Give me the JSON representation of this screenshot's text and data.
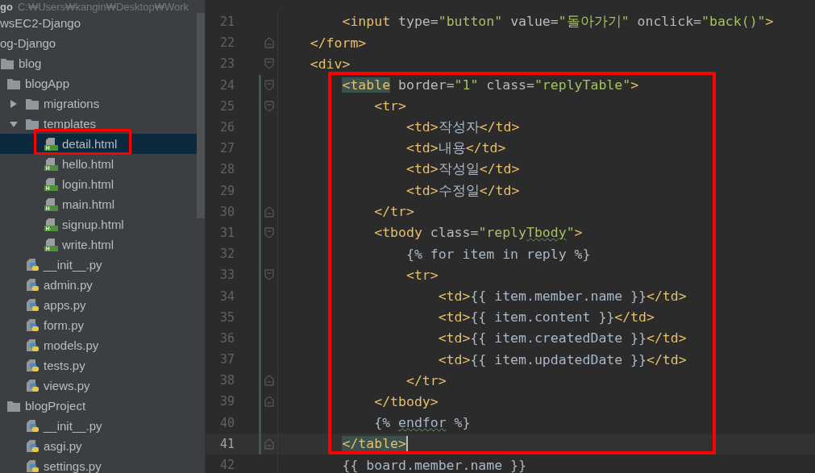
{
  "sidebar": {
    "root": {
      "name": "go",
      "path": "C:₩Users₩kangin₩Desktop₩Work"
    },
    "items": [
      {
        "label": "wsEC2-Django",
        "kind": "text",
        "selected": false
      },
      {
        "label": "og-Django",
        "kind": "text",
        "selected": false
      },
      {
        "label": "blog",
        "kind": "folder",
        "selected": false,
        "children": [
          {
            "label": "blogApp",
            "kind": "folder",
            "selected": false,
            "children": [
              {
                "label": "migrations",
                "kind": "folder",
                "expanded": false,
                "selected": false
              },
              {
                "label": "templates",
                "kind": "folder",
                "expanded": true,
                "selected": false,
                "children": [
                  {
                    "label": "detail.html",
                    "kind": "html",
                    "selected": true
                  },
                  {
                    "label": "hello.html",
                    "kind": "html",
                    "selected": false
                  },
                  {
                    "label": "login.html",
                    "kind": "html",
                    "selected": false
                  },
                  {
                    "label": "main.html",
                    "kind": "html",
                    "selected": false
                  },
                  {
                    "label": "signup.html",
                    "kind": "html",
                    "selected": false
                  },
                  {
                    "label": "write.html",
                    "kind": "html",
                    "selected": false
                  }
                ]
              },
              {
                "label": "__init__.py",
                "kind": "python",
                "selected": false
              },
              {
                "label": "admin.py",
                "kind": "python",
                "selected": false
              },
              {
                "label": "apps.py",
                "kind": "python",
                "selected": false
              },
              {
                "label": "form.py",
                "kind": "python",
                "selected": false
              },
              {
                "label": "models.py",
                "kind": "python",
                "selected": false
              },
              {
                "label": "tests.py",
                "kind": "python",
                "selected": false
              },
              {
                "label": "views.py",
                "kind": "python",
                "selected": false
              }
            ]
          },
          {
            "label": "blogProject",
            "kind": "folder",
            "selected": false,
            "children": [
              {
                "label": "__init__.py",
                "kind": "python",
                "selected": false
              },
              {
                "label": "asgi.py",
                "kind": "python",
                "selected": false
              },
              {
                "label": "settings.py",
                "kind": "python",
                "selected": false
              }
            ]
          }
        ]
      }
    ]
  },
  "editor": {
    "lines": [
      {
        "number": "21",
        "fold_open": false,
        "fold_close": false,
        "changed": false,
        "current": false,
        "tokens": [
          {
            "t": "        <input",
            "kind": "tag"
          },
          {
            "t": " type=",
            "kind": "attr"
          },
          {
            "t": "\"button\"",
            "kind": "val"
          },
          {
            "t": " value=",
            "kind": "attr"
          },
          {
            "t": "\"돌아가기\"",
            "kind": "val"
          },
          {
            "t": " onclick=",
            "kind": "attr"
          },
          {
            "t": "\"back()\"",
            "kind": "val"
          },
          {
            "t": ">",
            "kind": "tag"
          }
        ]
      },
      {
        "number": "22",
        "fold_open": false,
        "fold_close": true,
        "changed": false,
        "current": false,
        "tokens": [
          {
            "t": "    </form>",
            "kind": "tag"
          }
        ]
      },
      {
        "number": "23",
        "fold_open": true,
        "fold_close": false,
        "changed": false,
        "current": false,
        "tokens": [
          {
            "t": "    <div>",
            "kind": "tag"
          }
        ]
      },
      {
        "number": "24",
        "fold_open": true,
        "fold_close": false,
        "changed": true,
        "current": false,
        "tokens": [
          {
            "t": "        <table",
            "kind": "match"
          },
          {
            "t": " border=",
            "kind": "attr"
          },
          {
            "t": "\"1\"",
            "kind": "val"
          },
          {
            "t": " class=",
            "kind": "attr"
          },
          {
            "t": "\"replyTable\"",
            "kind": "val"
          },
          {
            "t": ">",
            "kind": "tag"
          }
        ]
      },
      {
        "number": "25",
        "fold_open": true,
        "fold_close": false,
        "changed": true,
        "current": false,
        "tokens": [
          {
            "t": "            <tr>",
            "kind": "tag"
          }
        ]
      },
      {
        "number": "26",
        "fold_open": false,
        "fold_close": false,
        "changed": true,
        "current": false,
        "tokens": [
          {
            "t": "                <td>",
            "kind": "tag"
          },
          {
            "t": "작성자",
            "kind": "text"
          },
          {
            "t": "</td>",
            "kind": "tag"
          }
        ]
      },
      {
        "number": "27",
        "fold_open": false,
        "fold_close": false,
        "changed": true,
        "current": false,
        "tokens": [
          {
            "t": "                <td>",
            "kind": "tag"
          },
          {
            "t": "내용",
            "kind": "text"
          },
          {
            "t": "</td>",
            "kind": "tag"
          }
        ]
      },
      {
        "number": "28",
        "fold_open": false,
        "fold_close": false,
        "changed": true,
        "current": false,
        "tokens": [
          {
            "t": "                <td>",
            "kind": "tag"
          },
          {
            "t": "작성일",
            "kind": "text"
          },
          {
            "t": "</td>",
            "kind": "tag"
          }
        ]
      },
      {
        "number": "29",
        "fold_open": false,
        "fold_close": false,
        "changed": true,
        "current": false,
        "tokens": [
          {
            "t": "                <td>",
            "kind": "tag"
          },
          {
            "t": "수정일",
            "kind": "text"
          },
          {
            "t": "</td>",
            "kind": "tag"
          }
        ]
      },
      {
        "number": "30",
        "fold_open": false,
        "fold_close": true,
        "changed": true,
        "current": false,
        "tokens": [
          {
            "t": "            </tr>",
            "kind": "tag"
          }
        ]
      },
      {
        "number": "31",
        "fold_open": true,
        "fold_close": false,
        "changed": true,
        "current": false,
        "tokens": [
          {
            "t": "            <tbody",
            "kind": "tag"
          },
          {
            "t": " class=",
            "kind": "attr"
          },
          {
            "t": "\"reply",
            "kind": "val",
            "typo": false
          },
          {
            "t": "Tbody",
            "kind": "val",
            "typo": true
          },
          {
            "t": "\"",
            "kind": "val",
            "typo": false
          },
          {
            "t": ">",
            "kind": "tag"
          }
        ]
      },
      {
        "number": "32",
        "fold_open": false,
        "fold_close": false,
        "changed": true,
        "current": false,
        "tokens": [
          {
            "t": "                {% for item in reply %}",
            "kind": "text"
          }
        ]
      },
      {
        "number": "33",
        "fold_open": true,
        "fold_close": false,
        "changed": true,
        "current": false,
        "tokens": [
          {
            "t": "                <tr>",
            "kind": "tag"
          }
        ]
      },
      {
        "number": "34",
        "fold_open": false,
        "fold_close": false,
        "changed": true,
        "current": false,
        "tokens": [
          {
            "t": "                    <td>",
            "kind": "tag"
          },
          {
            "t": "{{ item.member.name }}",
            "kind": "text"
          },
          {
            "t": "</td>",
            "kind": "tag"
          }
        ]
      },
      {
        "number": "35",
        "fold_open": false,
        "fold_close": false,
        "changed": true,
        "current": false,
        "tokens": [
          {
            "t": "                    <td>",
            "kind": "tag"
          },
          {
            "t": "{{ item.content }}",
            "kind": "text"
          },
          {
            "t": "</td>",
            "kind": "tag"
          }
        ]
      },
      {
        "number": "36",
        "fold_open": false,
        "fold_close": false,
        "changed": true,
        "current": false,
        "tokens": [
          {
            "t": "                    <td>",
            "kind": "tag"
          },
          {
            "t": "{{ item.createdDate }}",
            "kind": "text"
          },
          {
            "t": "</td>",
            "kind": "tag"
          }
        ]
      },
      {
        "number": "37",
        "fold_open": false,
        "fold_close": false,
        "changed": true,
        "current": false,
        "tokens": [
          {
            "t": "                    <td>",
            "kind": "tag"
          },
          {
            "t": "{{ item.updatedDate }}",
            "kind": "text"
          },
          {
            "t": "</td>",
            "kind": "tag"
          }
        ]
      },
      {
        "number": "38",
        "fold_open": false,
        "fold_close": true,
        "changed": true,
        "current": false,
        "tokens": [
          {
            "t": "                </tr>",
            "kind": "tag"
          }
        ]
      },
      {
        "number": "39",
        "fold_open": false,
        "fold_close": true,
        "changed": true,
        "current": false,
        "tokens": [
          {
            "t": "            </tbody>",
            "kind": "tag"
          }
        ]
      },
      {
        "number": "40",
        "fold_open": false,
        "fold_close": false,
        "changed": true,
        "current": false,
        "tokens": [
          {
            "t": "            {%",
            "kind": "text",
            "typo": false
          },
          {
            "t": " endfor",
            "kind": "text",
            "typo": true
          },
          {
            "t": " %}",
            "kind": "text",
            "typo": false
          }
        ]
      },
      {
        "number": "41",
        "fold_open": false,
        "fold_close": true,
        "changed": true,
        "current": true,
        "tokens": [
          {
            "t": "        </table>",
            "kind": "match"
          }
        ]
      },
      {
        "number": "42",
        "fold_open": false,
        "fold_close": false,
        "changed": false,
        "current": false,
        "tokens": [
          {
            "t": "        {{ board.member.name }}",
            "kind": "text"
          }
        ]
      }
    ]
  }
}
